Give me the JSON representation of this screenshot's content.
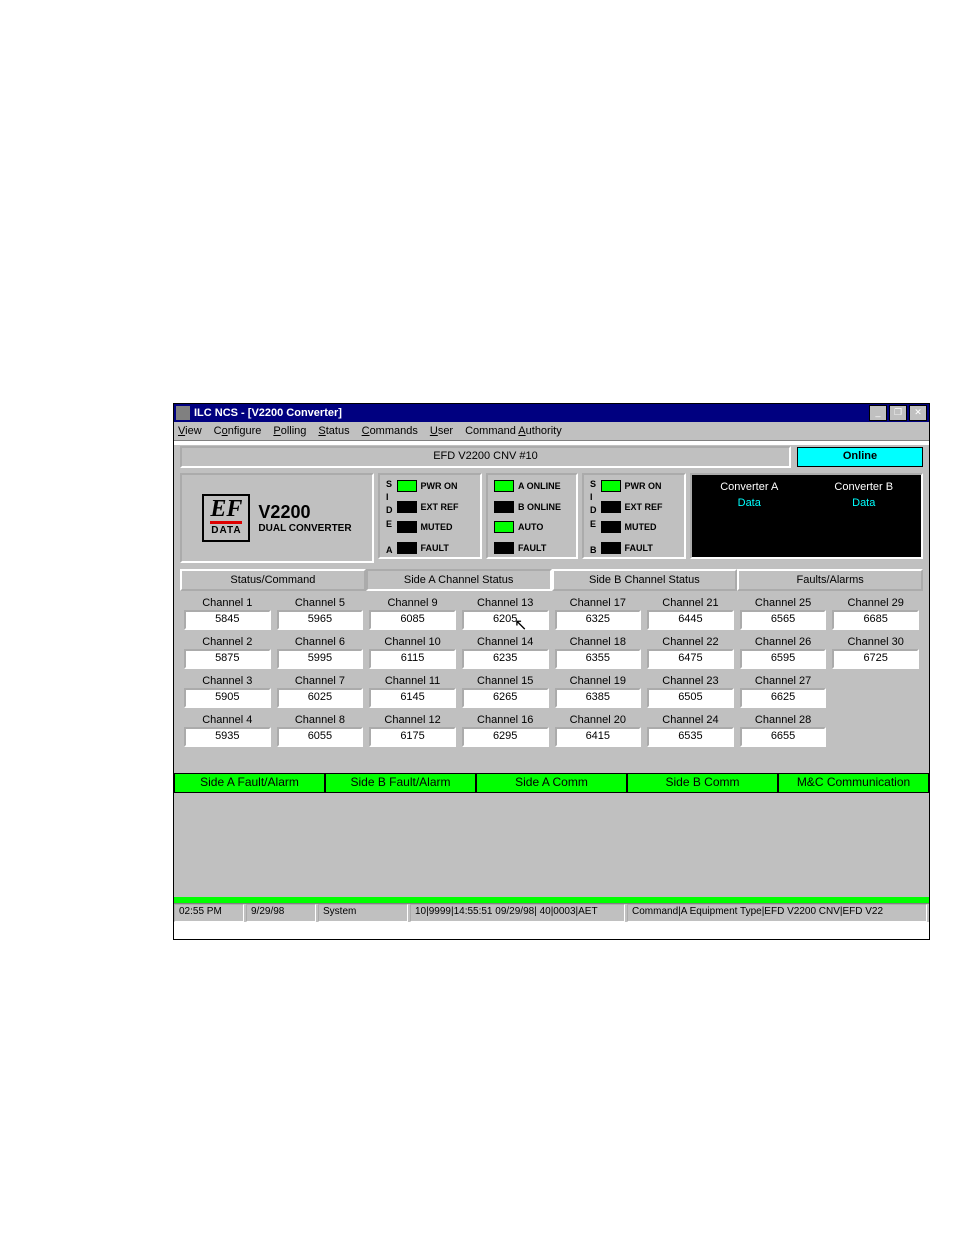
{
  "window": {
    "title": "ILC NCS - [V2200 Converter]"
  },
  "menu": [
    "View",
    "Configure",
    "Polling",
    "Status",
    "Commands",
    "User",
    "Command Authority"
  ],
  "device_title": "EFD V2200 CNV #10",
  "online_label": "Online",
  "logo": {
    "name": "V2200",
    "sub": "DUAL CONVERTER",
    "brand_top": "EF",
    "brand_bottom": "DATA"
  },
  "led_a": {
    "side": "SIDE A",
    "rows": [
      {
        "on": true,
        "label": "PWR ON"
      },
      {
        "on": false,
        "label": "EXT REF"
      },
      {
        "on": false,
        "label": "MUTED"
      },
      {
        "on": false,
        "label": "FAULT"
      }
    ]
  },
  "led_mid": {
    "rows": [
      {
        "on": true,
        "label": "A ONLINE"
      },
      {
        "on": false,
        "label": "B ONLINE"
      },
      {
        "on": true,
        "label": "AUTO"
      },
      {
        "on": false,
        "label": "FAULT"
      }
    ]
  },
  "led_b": {
    "side": "SIDE B",
    "rows": [
      {
        "on": true,
        "label": "PWR ON"
      },
      {
        "on": false,
        "label": "EXT REF"
      },
      {
        "on": false,
        "label": "MUTED"
      },
      {
        "on": false,
        "label": "FAULT"
      }
    ]
  },
  "conv_a": {
    "title": "Converter A",
    "data": "Data"
  },
  "conv_b": {
    "title": "Converter B",
    "data": "Data"
  },
  "tabs": [
    "Status/Command",
    "Side A Channel Status",
    "Side B Channel Status",
    "Faults/Alarms"
  ],
  "active_tab": 1,
  "channels": [
    {
      "label": "Channel 1",
      "value": "5845"
    },
    {
      "label": "Channel 5",
      "value": "5965"
    },
    {
      "label": "Channel 9",
      "value": "6085"
    },
    {
      "label": "Channel 13",
      "value": "6205"
    },
    {
      "label": "Channel 17",
      "value": "6325"
    },
    {
      "label": "Channel 21",
      "value": "6445"
    },
    {
      "label": "Channel 25",
      "value": "6565"
    },
    {
      "label": "Channel 29",
      "value": "6685"
    },
    {
      "label": "Channel 2",
      "value": "5875"
    },
    {
      "label": "Channel 6",
      "value": "5995"
    },
    {
      "label": "Channel 10",
      "value": "6115"
    },
    {
      "label": "Channel 14",
      "value": "6235"
    },
    {
      "label": "Channel 18",
      "value": "6355"
    },
    {
      "label": "Channel 22",
      "value": "6475"
    },
    {
      "label": "Channel 26",
      "value": "6595"
    },
    {
      "label": "Channel 30",
      "value": "6725"
    },
    {
      "label": "Channel 3",
      "value": "5905"
    },
    {
      "label": "Channel 7",
      "value": "6025"
    },
    {
      "label": "Channel 11",
      "value": "6145"
    },
    {
      "label": "Channel 15",
      "value": "6265"
    },
    {
      "label": "Channel 19",
      "value": "6385"
    },
    {
      "label": "Channel 23",
      "value": "6505"
    },
    {
      "label": "Channel 27",
      "value": "6625"
    },
    {
      "label": "",
      "value": ""
    },
    {
      "label": "Channel 4",
      "value": "5935"
    },
    {
      "label": "Channel 8",
      "value": "6055"
    },
    {
      "label": "Channel 12",
      "value": "6175"
    },
    {
      "label": "Channel 16",
      "value": "6295"
    },
    {
      "label": "Channel 20",
      "value": "6415"
    },
    {
      "label": "Channel 24",
      "value": "6535"
    },
    {
      "label": "Channel 28",
      "value": "6655"
    },
    {
      "label": "",
      "value": ""
    }
  ],
  "greenbar": [
    "Side A Fault/Alarm",
    "Side B Fault/Alarm",
    "Side A Comm",
    "Side B Comm",
    "M&C Communication"
  ],
  "status": {
    "time": "02:55 PM",
    "date": "9/29/98",
    "user": "System",
    "cmdid": "10|9999|14:55:51 09/29/98| 40|0003|AET",
    "cmdlbl": "Command|A Equipment Type|EFD V2200 CNV|EFD V22"
  }
}
